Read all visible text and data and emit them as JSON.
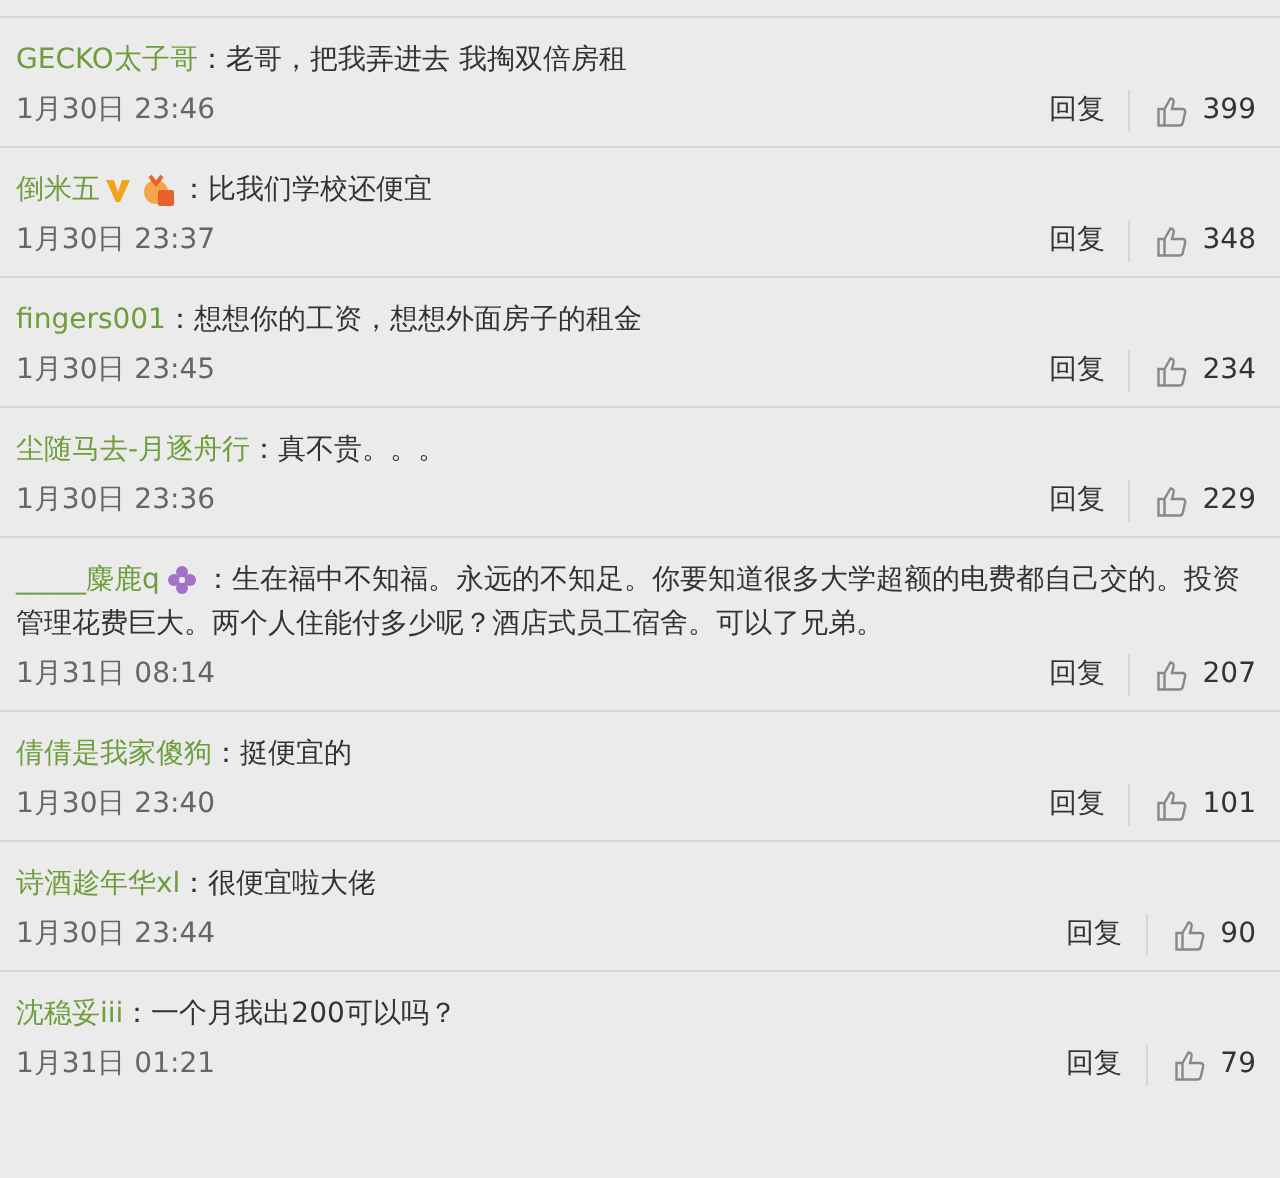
{
  "comments": [
    {
      "user": "GECKO太子哥",
      "text": "：老哥，把我弄进去 我掏双倍房租",
      "time": "1月30日 23:46",
      "reply": "回复",
      "likes": "399"
    },
    {
      "user": "倒米五",
      "badges": [
        {
          "kind": "v"
        },
        {
          "kind": "medal"
        }
      ],
      "text": "：比我们学校还便宜",
      "time": "1月30日 23:37",
      "reply": "回复",
      "likes": "348"
    },
    {
      "user": "fingers001",
      "text": "：想想你的工资，想想外面房子的租金",
      "time": "1月30日 23:45",
      "reply": "回复",
      "likes": "234"
    },
    {
      "user": "尘随马去-月逐舟行",
      "text": "：真不贵。。。",
      "time": "1月30日 23:36",
      "reply": "回复",
      "likes": "229"
    },
    {
      "user": "_____麋鹿q",
      "badges": [
        {
          "kind": "flower"
        }
      ],
      "text": "：生在福中不知福。永远的不知足。你要知道很多大学超额的电费都自己交的。投资管理花费巨大。两个人住能付多少呢？酒店式员工宿舍。可以了兄弟。",
      "time": "1月31日 08:14",
      "reply": "回复",
      "likes": "207"
    },
    {
      "user": "倩倩是我家傻狗",
      "text": "：挺便宜的",
      "time": "1月30日 23:40",
      "reply": "回复",
      "likes": "101"
    },
    {
      "user": "诗酒趁年华xl",
      "text": "：很便宜啦大佬",
      "time": "1月30日 23:44",
      "reply": "回复",
      "likes": "90"
    },
    {
      "user": "沈稳妥iii",
      "text": "：一个月我出200可以吗？",
      "time": "1月31日 01:21",
      "reply": "回复",
      "likes": "79"
    }
  ]
}
